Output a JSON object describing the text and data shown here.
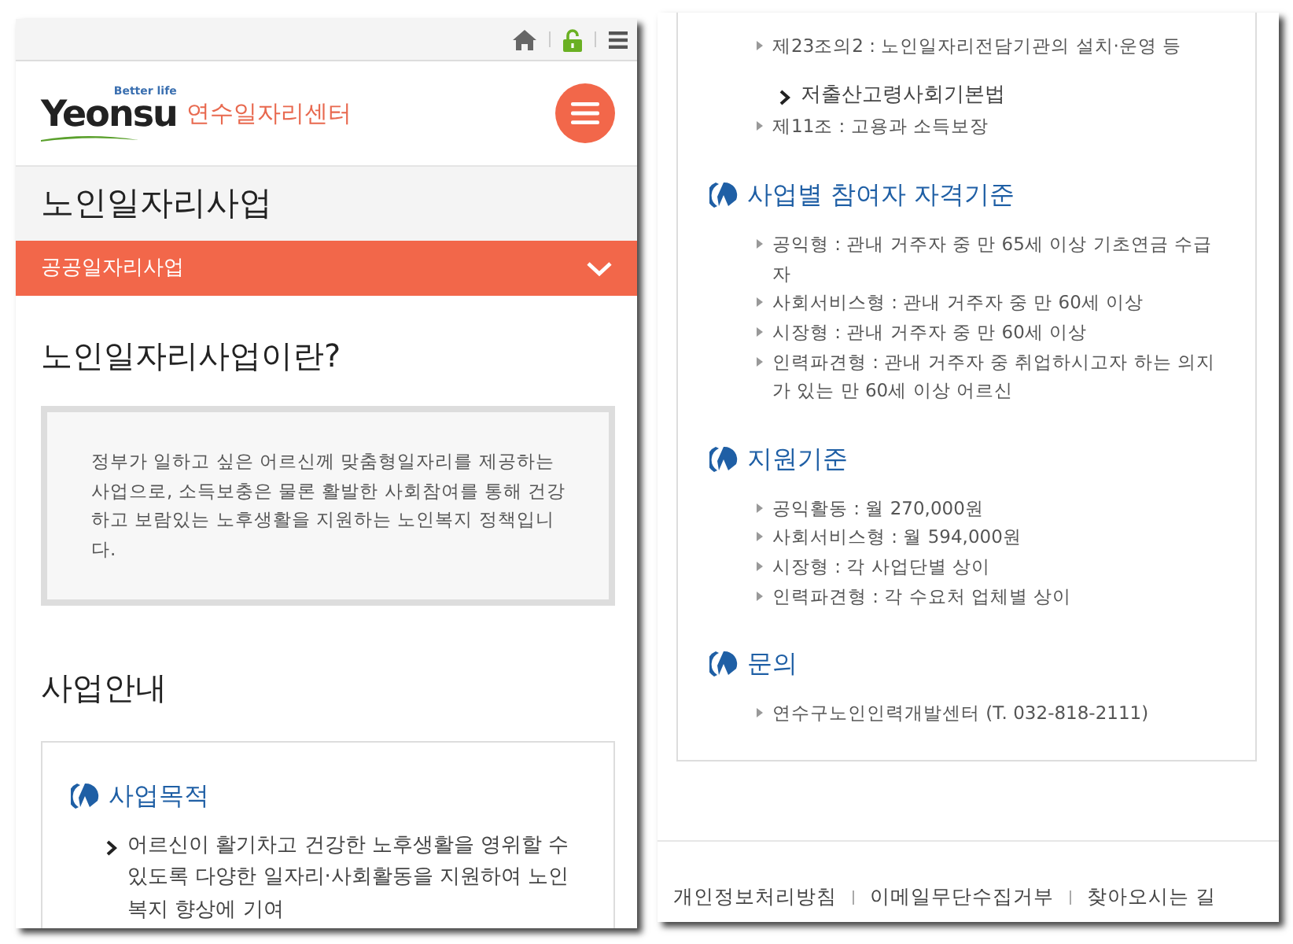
{
  "left_screen": {
    "logo": {
      "wordmark": "Yeonsu",
      "tagline": "Better life"
    },
    "site_name": "연수일자리센터",
    "page_title": "노인일자리사업",
    "submenu": {
      "label": "공공일자리사업"
    },
    "intro": {
      "heading": "노인일자리사업이란?",
      "text": "정부가 일하고 싶은 어르신께 맞춤형일자리를 제공하는 사업으로, 소득보충은 물론 활발한 사회참여를 통해 건강하고 보람있는 노후생활을 지원하는 노인복지 정책입니다."
    },
    "guide": {
      "heading": "사업안내",
      "sections": [
        {
          "title": "사업목적",
          "items": [
            {
              "kind": "main",
              "text": "어르신이 활기차고 건강한 노후생활을 영위할 수 있도록 다양한 일자리·사회활동을 지원하여 노인복지 향상에 기여"
            }
          ]
        }
      ]
    }
  },
  "right_screen": {
    "sections": [
      {
        "items": [
          {
            "kind": "sub",
            "text": "제23조의2 : 노인일자리전담기관의 설치·운영 등"
          },
          {
            "kind": "main",
            "text": "저출산고령사회기본법"
          },
          {
            "kind": "sub",
            "text": "제11조 : 고용과 소득보장"
          }
        ]
      },
      {
        "title": "사업별 참여자 자격기준",
        "items": [
          {
            "kind": "sub",
            "text": "공익형 : 관내 거주자 중 만 65세 이상 기초연금 수급자"
          },
          {
            "kind": "sub",
            "text": "사회서비스형 : 관내 거주자 중 만 60세 이상"
          },
          {
            "kind": "sub",
            "text": "시장형 : 관내 거주자 중 만 60세 이상"
          },
          {
            "kind": "sub",
            "text": "인력파견형 : 관내 거주자 중 취업하시고자 하는 의지가 있는 만 60세 이상 어르신"
          }
        ]
      },
      {
        "title": "지원기준",
        "items": [
          {
            "kind": "sub",
            "text": "공익활동 : 월 270,000원"
          },
          {
            "kind": "sub",
            "text": "사회서비스형 : 월 594,000원"
          },
          {
            "kind": "sub",
            "text": "시장형 : 각 사업단별 상이"
          },
          {
            "kind": "sub",
            "text": "인력파견형 : 각 수요처 업체별 상이"
          }
        ]
      },
      {
        "title": "문의",
        "items": [
          {
            "kind": "sub",
            "text": "연수구노인인력개발센터 (T. 032-818-2111)"
          }
        ]
      }
    ],
    "footer_links": [
      "개인정보처리방침",
      "이메일무단수집거부",
      "찾아오시는 길"
    ]
  }
}
